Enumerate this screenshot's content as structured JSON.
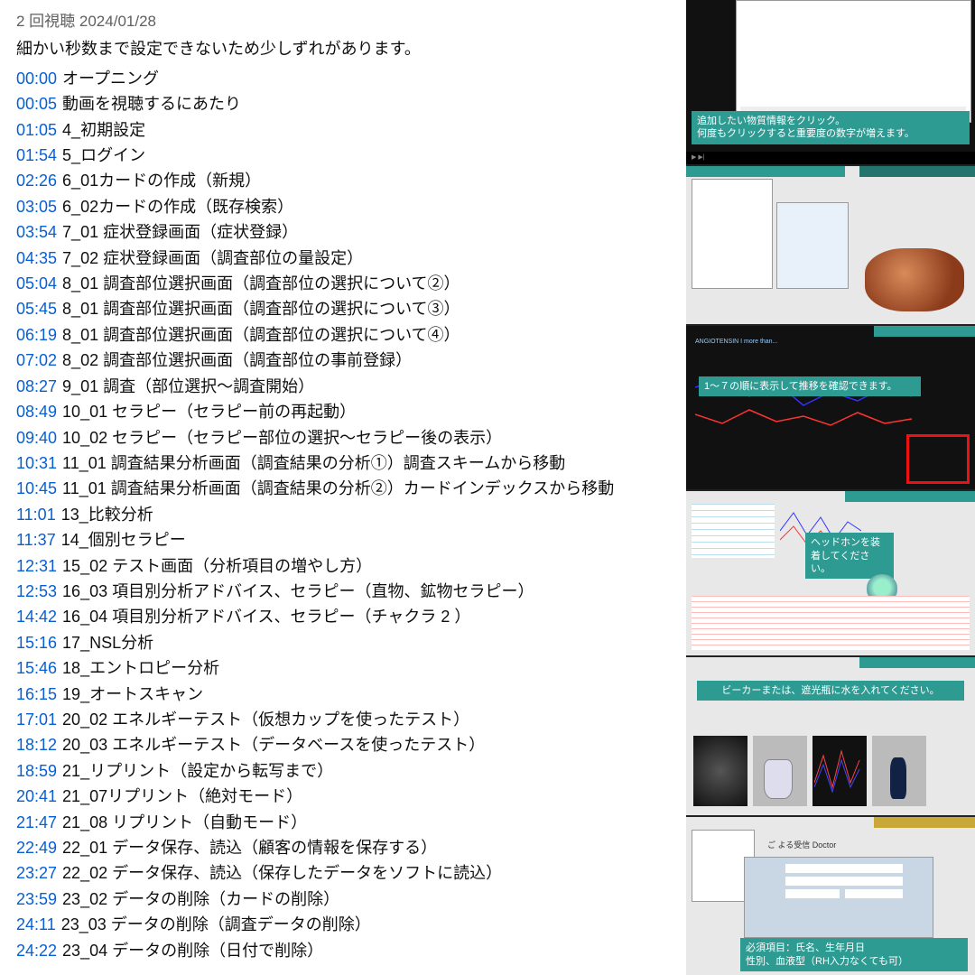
{
  "header": {
    "views_date": "2 回視聴  2024/01/28",
    "note": "細かい秒数まで設定できないため少しずれがあります。"
  },
  "chapters": [
    {
      "ts": "00:00",
      "title": "オープニング"
    },
    {
      "ts": "00:05",
      "title": "動画を視聴するにあたり"
    },
    {
      "ts": "01:05",
      "title": "4_初期設定"
    },
    {
      "ts": "01:54",
      "title": "5_ログイン"
    },
    {
      "ts": "02:26",
      "title": "6_01カードの作成（新規）"
    },
    {
      "ts": "03:05",
      "title": "6_02カードの作成（既存検索）"
    },
    {
      "ts": "03:54",
      "title": "7_01 症状登録画面（症状登録）"
    },
    {
      "ts": "04:35",
      "title": "7_02 症状登録画面（調査部位の量設定）"
    },
    {
      "ts": "05:04",
      "title": "8_01 調査部位選択画面（調査部位の選択について②）"
    },
    {
      "ts": "05:45",
      "title": "8_01 調査部位選択画面（調査部位の選択について③）"
    },
    {
      "ts": "06:19",
      "title": "8_01 調査部位選択画面（調査部位の選択について④）"
    },
    {
      "ts": "07:02",
      "title": "8_02 調査部位選択画面（調査部位の事前登録）"
    },
    {
      "ts": "08:27",
      "title": "9_01 調査（部位選択〜調査開始）"
    },
    {
      "ts": "08:49",
      "title": "10_01 セラピー（セラピー前の再起動）"
    },
    {
      "ts": "09:40",
      "title": "10_02 セラピー（セラピー部位の選択〜セラピー後の表示）"
    },
    {
      "ts": "10:31",
      "title": "11_01 調査結果分析画面（調査結果の分析①）調査スキームから移動"
    },
    {
      "ts": "10:45",
      "title": "11_01 調査結果分析画面（調査結果の分析②）カードインデックスから移動"
    },
    {
      "ts": "11:01",
      "title": "13_比較分析"
    },
    {
      "ts": "11:37",
      "title": "14_個別セラピー"
    },
    {
      "ts": "12:31",
      "title": "15_02 テスト画面（分析項目の増やし方）"
    },
    {
      "ts": "12:53",
      "title": "16_03 項目別分析アドバイス、セラピー（直物、鉱物セラピー）"
    },
    {
      "ts": "14:42",
      "title": "16_04 項目別分析アドバイス、セラピー（チャクラ 2 ）"
    },
    {
      "ts": "15:16",
      "title": "17_NSL分析"
    },
    {
      "ts": "15:46",
      "title": "18_エントロピー分析"
    },
    {
      "ts": "16:15",
      "title": "19_オートスキャン"
    },
    {
      "ts": "17:01",
      "title": "20_02 エネルギーテスト（仮想カップを使ったテスト）"
    },
    {
      "ts": "18:12",
      "title": "20_03 エネルギーテスト（データベースを使ったテスト）"
    },
    {
      "ts": "18:59",
      "title": "21_リプリント（設定から転写まで）"
    },
    {
      "ts": "20:41",
      "title": "21_07リプリント（絶対モード）"
    },
    {
      "ts": "21:47",
      "title": "21_08 リプリント（自動モード）"
    },
    {
      "ts": "22:49",
      "title": "22_01 データ保存、読込（顧客の情報を保存する）"
    },
    {
      "ts": "23:27",
      "title": "22_02 データ保存、読込（保存したデータをソフトに読込）"
    },
    {
      "ts": "23:59",
      "title": "23_02 データの削除（カードの削除）"
    },
    {
      "ts": "24:11",
      "title": "23_03 データの削除（調査データの削除）"
    },
    {
      "ts": "24:22",
      "title": "23_04 データの削除（日付で削除）"
    }
  ],
  "thumbs": {
    "c0": "追加したい物質情報をクリック。\n何度もクリックすると重要度の数字が増えます。",
    "c1": "1〜７の順に表示して推移を確認できます。",
    "c2": "ヘッドホンを装着してください。",
    "c3": "ビーカーまたは、遮光瓶に水を入れてください。",
    "c4": "必須項目：氏名、生年月日\n性別、血液型（RH入力なくても可）",
    "doctor": "ご よる受信 Doctor"
  }
}
